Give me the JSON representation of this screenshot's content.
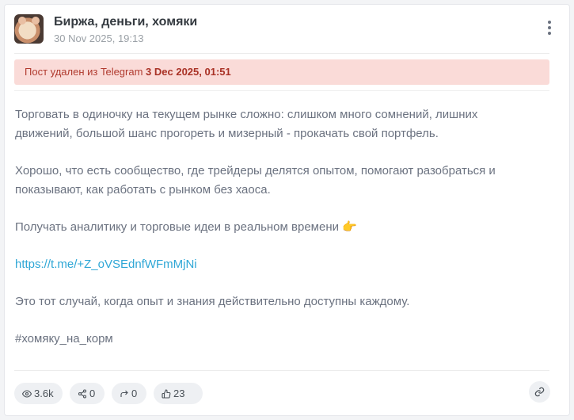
{
  "channel": {
    "title": "Биржа, деньги, хомяки",
    "date": "30 Nov 2025, 19:13"
  },
  "banner": {
    "text": "Пост удален из Telegram ",
    "date": "3 Dec 2025, 01:51"
  },
  "post": {
    "p1": "Торговать в одиночку на текущем рынке сложно: слишком много сомнений, лишних движений, большой шанс прогореть и мизерный - прокачать свой портфель.",
    "p2": "Хорошо, что есть сообщество, где трейдеры делятся опытом, помогают разобраться и показывают, как работать с рынком без хаоса.",
    "p3": "Получать аналитику и торговые идеи в реальном времени",
    "p3_emoji": "👉",
    "link": "https://t.me/+Z_oVSEdnfWFmMjNi",
    "p4": "Это тот случай, когда опыт и знания действительно доступны каждому.",
    "hashtag": "#хомяку_на_корм"
  },
  "stats": {
    "views": "3.6k",
    "shares": "0",
    "forwards": "0",
    "reactions": "23"
  },
  "colors": {
    "banner_bg": "#fadbd8",
    "banner_text": "#b03a2e",
    "link": "#2fa7d6"
  },
  "icons": [
    "more-vertical-icon",
    "eye-icon",
    "share-icon",
    "forward-icon",
    "thumbs-up-icon",
    "link-icon"
  ]
}
